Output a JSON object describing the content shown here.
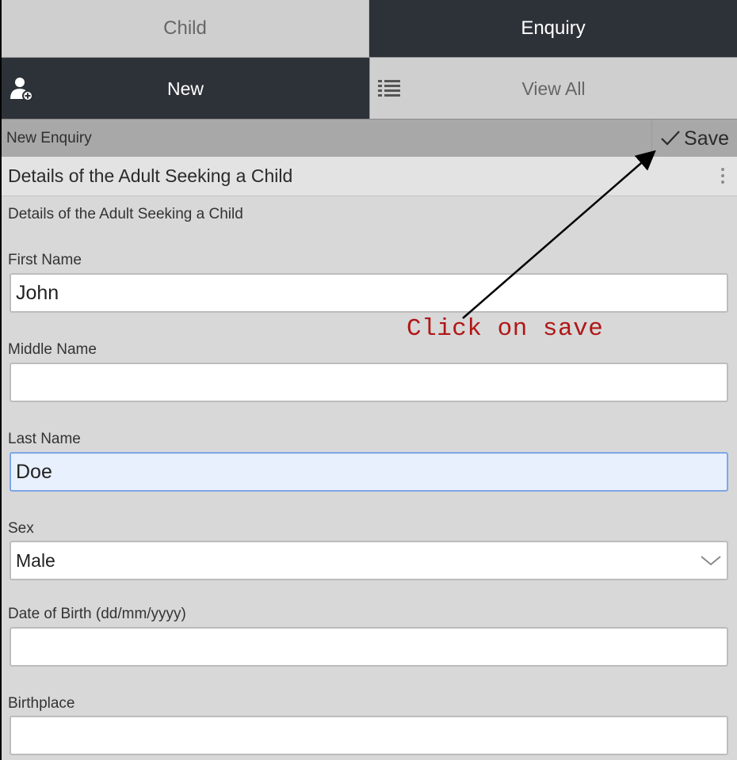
{
  "tabs": [
    {
      "label": "Child",
      "active": false
    },
    {
      "label": "Enquiry",
      "active": true
    }
  ],
  "subnav": {
    "new_label": "New",
    "view_all_label": "View All",
    "new_icon": "add-user-icon",
    "view_all_icon": "list-icon"
  },
  "actionbar": {
    "title": "New Enquiry",
    "save_label": "Save",
    "save_icon": "checkmark-icon"
  },
  "section": {
    "header": "Details of the Adult Seeking a Child",
    "subheader": "Details of the Adult Seeking a Child",
    "menu_icon": "kebab-menu-icon"
  },
  "form": {
    "first_name": {
      "label": "First Name",
      "value": "John"
    },
    "middle_name": {
      "label": "Middle Name",
      "value": ""
    },
    "last_name": {
      "label": "Last Name",
      "value": "Doe"
    },
    "sex": {
      "label": "Sex",
      "value": "Male"
    },
    "dob": {
      "label": "Date of Birth (dd/mm/yyyy)",
      "value": ""
    },
    "birthplace": {
      "label": "Birthplace",
      "value": ""
    }
  },
  "annotation": {
    "text": "Click on save",
    "color": "#b01717"
  },
  "colors": {
    "dark_tab": "#2d3138",
    "light_tab": "#cfcfcf",
    "actionbar": "#a8a8a8",
    "focus_border": "#7ea6e6"
  }
}
